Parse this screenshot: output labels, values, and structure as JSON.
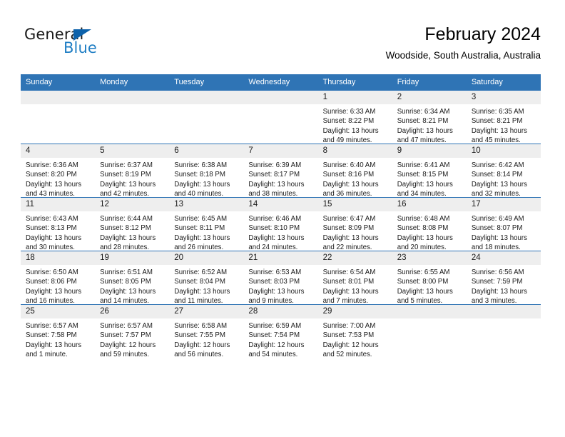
{
  "brand": {
    "name_part1": "General",
    "name_part2": "Blue",
    "triangle_icon": "triangle-icon",
    "accent_color": "#1f7ec4",
    "triangle_color": "#0d62ab"
  },
  "header": {
    "title": "February 2024",
    "subtitle": "Woodside, South Australia, Australia"
  },
  "theme": {
    "header_band": "#2F74B5",
    "daynum_band": "#EEEEEE",
    "week_divider": "#2F74B5",
    "text": "#1A1A1A"
  },
  "weekdays": [
    "Sunday",
    "Monday",
    "Tuesday",
    "Wednesday",
    "Thursday",
    "Friday",
    "Saturday"
  ],
  "labels": {
    "sunrise_prefix": "Sunrise:",
    "sunset_prefix": "Sunset:",
    "daylight_prefix": "Daylight:"
  },
  "weeks": [
    [
      {
        "day": "",
        "sunrise": "",
        "sunset": "",
        "daylight1": "",
        "daylight2": ""
      },
      {
        "day": "",
        "sunrise": "",
        "sunset": "",
        "daylight1": "",
        "daylight2": ""
      },
      {
        "day": "",
        "sunrise": "",
        "sunset": "",
        "daylight1": "",
        "daylight2": ""
      },
      {
        "day": "",
        "sunrise": "",
        "sunset": "",
        "daylight1": "",
        "daylight2": ""
      },
      {
        "day": "1",
        "sunrise": "Sunrise: 6:33 AM",
        "sunset": "Sunset: 8:22 PM",
        "daylight1": "Daylight: 13 hours",
        "daylight2": "and 49 minutes."
      },
      {
        "day": "2",
        "sunrise": "Sunrise: 6:34 AM",
        "sunset": "Sunset: 8:21 PM",
        "daylight1": "Daylight: 13 hours",
        "daylight2": "and 47 minutes."
      },
      {
        "day": "3",
        "sunrise": "Sunrise: 6:35 AM",
        "sunset": "Sunset: 8:21 PM",
        "daylight1": "Daylight: 13 hours",
        "daylight2": "and 45 minutes."
      }
    ],
    [
      {
        "day": "4",
        "sunrise": "Sunrise: 6:36 AM",
        "sunset": "Sunset: 8:20 PM",
        "daylight1": "Daylight: 13 hours",
        "daylight2": "and 43 minutes."
      },
      {
        "day": "5",
        "sunrise": "Sunrise: 6:37 AM",
        "sunset": "Sunset: 8:19 PM",
        "daylight1": "Daylight: 13 hours",
        "daylight2": "and 42 minutes."
      },
      {
        "day": "6",
        "sunrise": "Sunrise: 6:38 AM",
        "sunset": "Sunset: 8:18 PM",
        "daylight1": "Daylight: 13 hours",
        "daylight2": "and 40 minutes."
      },
      {
        "day": "7",
        "sunrise": "Sunrise: 6:39 AM",
        "sunset": "Sunset: 8:17 PM",
        "daylight1": "Daylight: 13 hours",
        "daylight2": "and 38 minutes."
      },
      {
        "day": "8",
        "sunrise": "Sunrise: 6:40 AM",
        "sunset": "Sunset: 8:16 PM",
        "daylight1": "Daylight: 13 hours",
        "daylight2": "and 36 minutes."
      },
      {
        "day": "9",
        "sunrise": "Sunrise: 6:41 AM",
        "sunset": "Sunset: 8:15 PM",
        "daylight1": "Daylight: 13 hours",
        "daylight2": "and 34 minutes."
      },
      {
        "day": "10",
        "sunrise": "Sunrise: 6:42 AM",
        "sunset": "Sunset: 8:14 PM",
        "daylight1": "Daylight: 13 hours",
        "daylight2": "and 32 minutes."
      }
    ],
    [
      {
        "day": "11",
        "sunrise": "Sunrise: 6:43 AM",
        "sunset": "Sunset: 8:13 PM",
        "daylight1": "Daylight: 13 hours",
        "daylight2": "and 30 minutes."
      },
      {
        "day": "12",
        "sunrise": "Sunrise: 6:44 AM",
        "sunset": "Sunset: 8:12 PM",
        "daylight1": "Daylight: 13 hours",
        "daylight2": "and 28 minutes."
      },
      {
        "day": "13",
        "sunrise": "Sunrise: 6:45 AM",
        "sunset": "Sunset: 8:11 PM",
        "daylight1": "Daylight: 13 hours",
        "daylight2": "and 26 minutes."
      },
      {
        "day": "14",
        "sunrise": "Sunrise: 6:46 AM",
        "sunset": "Sunset: 8:10 PM",
        "daylight1": "Daylight: 13 hours",
        "daylight2": "and 24 minutes."
      },
      {
        "day": "15",
        "sunrise": "Sunrise: 6:47 AM",
        "sunset": "Sunset: 8:09 PM",
        "daylight1": "Daylight: 13 hours",
        "daylight2": "and 22 minutes."
      },
      {
        "day": "16",
        "sunrise": "Sunrise: 6:48 AM",
        "sunset": "Sunset: 8:08 PM",
        "daylight1": "Daylight: 13 hours",
        "daylight2": "and 20 minutes."
      },
      {
        "day": "17",
        "sunrise": "Sunrise: 6:49 AM",
        "sunset": "Sunset: 8:07 PM",
        "daylight1": "Daylight: 13 hours",
        "daylight2": "and 18 minutes."
      }
    ],
    [
      {
        "day": "18",
        "sunrise": "Sunrise: 6:50 AM",
        "sunset": "Sunset: 8:06 PM",
        "daylight1": "Daylight: 13 hours",
        "daylight2": "and 16 minutes."
      },
      {
        "day": "19",
        "sunrise": "Sunrise: 6:51 AM",
        "sunset": "Sunset: 8:05 PM",
        "daylight1": "Daylight: 13 hours",
        "daylight2": "and 14 minutes."
      },
      {
        "day": "20",
        "sunrise": "Sunrise: 6:52 AM",
        "sunset": "Sunset: 8:04 PM",
        "daylight1": "Daylight: 13 hours",
        "daylight2": "and 11 minutes."
      },
      {
        "day": "21",
        "sunrise": "Sunrise: 6:53 AM",
        "sunset": "Sunset: 8:03 PM",
        "daylight1": "Daylight: 13 hours",
        "daylight2": "and 9 minutes."
      },
      {
        "day": "22",
        "sunrise": "Sunrise: 6:54 AM",
        "sunset": "Sunset: 8:01 PM",
        "daylight1": "Daylight: 13 hours",
        "daylight2": "and 7 minutes."
      },
      {
        "day": "23",
        "sunrise": "Sunrise: 6:55 AM",
        "sunset": "Sunset: 8:00 PM",
        "daylight1": "Daylight: 13 hours",
        "daylight2": "and 5 minutes."
      },
      {
        "day": "24",
        "sunrise": "Sunrise: 6:56 AM",
        "sunset": "Sunset: 7:59 PM",
        "daylight1": "Daylight: 13 hours",
        "daylight2": "and 3 minutes."
      }
    ],
    [
      {
        "day": "25",
        "sunrise": "Sunrise: 6:57 AM",
        "sunset": "Sunset: 7:58 PM",
        "daylight1": "Daylight: 13 hours",
        "daylight2": "and 1 minute."
      },
      {
        "day": "26",
        "sunrise": "Sunrise: 6:57 AM",
        "sunset": "Sunset: 7:57 PM",
        "daylight1": "Daylight: 12 hours",
        "daylight2": "and 59 minutes."
      },
      {
        "day": "27",
        "sunrise": "Sunrise: 6:58 AM",
        "sunset": "Sunset: 7:55 PM",
        "daylight1": "Daylight: 12 hours",
        "daylight2": "and 56 minutes."
      },
      {
        "day": "28",
        "sunrise": "Sunrise: 6:59 AM",
        "sunset": "Sunset: 7:54 PM",
        "daylight1": "Daylight: 12 hours",
        "daylight2": "and 54 minutes."
      },
      {
        "day": "29",
        "sunrise": "Sunrise: 7:00 AM",
        "sunset": "Sunset: 7:53 PM",
        "daylight1": "Daylight: 12 hours",
        "daylight2": "and 52 minutes."
      },
      {
        "day": "",
        "sunrise": "",
        "sunset": "",
        "daylight1": "",
        "daylight2": ""
      },
      {
        "day": "",
        "sunrise": "",
        "sunset": "",
        "daylight1": "",
        "daylight2": ""
      }
    ]
  ]
}
